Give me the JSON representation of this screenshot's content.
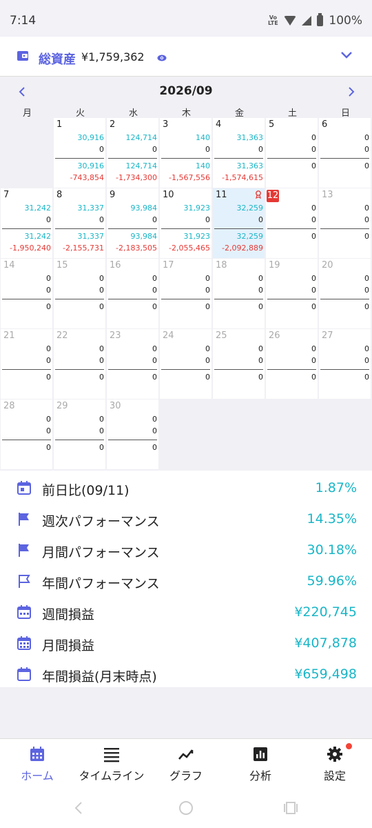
{
  "status": {
    "time": "7:14",
    "volte": "Vo LTE",
    "battery": "100%"
  },
  "asset": {
    "label": "総資産",
    "value": "¥1,759,362"
  },
  "calendar": {
    "month": "2026/09",
    "weekdays": [
      "月",
      "火",
      "水",
      "木",
      "金",
      "土",
      "日"
    ],
    "days": [
      {
        "d": "1",
        "col": 1,
        "row": 0,
        "v1": "30,916",
        "v2": "0",
        "v3": "30,916",
        "v4": "-743,854"
      },
      {
        "d": "2",
        "col": 2,
        "row": 0,
        "v1": "124,714",
        "v2": "0",
        "v3": "124,714",
        "v4": "-1,734,300"
      },
      {
        "d": "3",
        "col": 3,
        "row": 0,
        "v1": "140",
        "v2": "0",
        "v3": "140",
        "v4": "-1,567,556"
      },
      {
        "d": "4",
        "col": 4,
        "row": 0,
        "v1": "31,363",
        "v2": "0",
        "v3": "31,363",
        "v4": "-1,574,615"
      },
      {
        "d": "5",
        "col": 5,
        "row": 0,
        "v1": "0",
        "v2": "0",
        "v3": "0",
        "v4": ""
      },
      {
        "d": "6",
        "col": 6,
        "row": 0,
        "v1": "0",
        "v2": "0",
        "v3": "0",
        "v4": ""
      },
      {
        "d": "7",
        "col": 0,
        "row": 1,
        "v1": "31,242",
        "v2": "0",
        "v3": "31,242",
        "v4": "-1,950,240"
      },
      {
        "d": "8",
        "col": 1,
        "row": 1,
        "v1": "31,337",
        "v2": "0",
        "v3": "31,337",
        "v4": "-2,155,731"
      },
      {
        "d": "9",
        "col": 2,
        "row": 1,
        "v1": "93,984",
        "v2": "0",
        "v3": "93,984",
        "v4": "-2,183,505"
      },
      {
        "d": "10",
        "col": 3,
        "row": 1,
        "v1": "31,923",
        "v2": "0",
        "v3": "31,923",
        "v4": "-2,055,465"
      },
      {
        "d": "11",
        "col": 4,
        "row": 1,
        "v1": "32,259",
        "v2": "0",
        "v3": "32,259",
        "v4": "-2,092,889",
        "today": true
      },
      {
        "d": "12",
        "col": 5,
        "row": 1,
        "v1": "0",
        "v2": "0",
        "v3": "0",
        "v4": "",
        "selected": true
      },
      {
        "d": "13",
        "col": 6,
        "row": 1,
        "v1": "0",
        "v2": "0",
        "v3": "0",
        "v4": "",
        "muted": true
      },
      {
        "d": "14",
        "col": 0,
        "row": 2,
        "v1": "0",
        "v2": "0",
        "v3": "0",
        "v4": "",
        "muted": true
      },
      {
        "d": "15",
        "col": 1,
        "row": 2,
        "v1": "0",
        "v2": "0",
        "v3": "0",
        "v4": "",
        "muted": true
      },
      {
        "d": "16",
        "col": 2,
        "row": 2,
        "v1": "0",
        "v2": "0",
        "v3": "0",
        "v4": "",
        "muted": true
      },
      {
        "d": "17",
        "col": 3,
        "row": 2,
        "v1": "0",
        "v2": "0",
        "v3": "0",
        "v4": "",
        "muted": true
      },
      {
        "d": "18",
        "col": 4,
        "row": 2,
        "v1": "0",
        "v2": "0",
        "v3": "0",
        "v4": "",
        "muted": true
      },
      {
        "d": "19",
        "col": 5,
        "row": 2,
        "v1": "0",
        "v2": "0",
        "v3": "0",
        "v4": "",
        "muted": true
      },
      {
        "d": "20",
        "col": 6,
        "row": 2,
        "v1": "0",
        "v2": "0",
        "v3": "0",
        "v4": "",
        "muted": true
      },
      {
        "d": "21",
        "col": 0,
        "row": 3,
        "v1": "0",
        "v2": "0",
        "v3": "0",
        "v4": "",
        "muted": true
      },
      {
        "d": "22",
        "col": 1,
        "row": 3,
        "v1": "0",
        "v2": "0",
        "v3": "0",
        "v4": "",
        "muted": true
      },
      {
        "d": "23",
        "col": 2,
        "row": 3,
        "v1": "0",
        "v2": "0",
        "v3": "0",
        "v4": "",
        "muted": true
      },
      {
        "d": "24",
        "col": 3,
        "row": 3,
        "v1": "0",
        "v2": "0",
        "v3": "0",
        "v4": "",
        "muted": true
      },
      {
        "d": "25",
        "col": 4,
        "row": 3,
        "v1": "0",
        "v2": "0",
        "v3": "0",
        "v4": "",
        "muted": true
      },
      {
        "d": "26",
        "col": 5,
        "row": 3,
        "v1": "0",
        "v2": "0",
        "v3": "0",
        "v4": "",
        "muted": true
      },
      {
        "d": "27",
        "col": 6,
        "row": 3,
        "v1": "0",
        "v2": "0",
        "v3": "0",
        "v4": "",
        "muted": true
      },
      {
        "d": "28",
        "col": 0,
        "row": 4,
        "v1": "0",
        "v2": "0",
        "v3": "0",
        "v4": "",
        "muted": true
      },
      {
        "d": "29",
        "col": 1,
        "row": 4,
        "v1": "0",
        "v2": "0",
        "v3": "0",
        "v4": "",
        "muted": true
      },
      {
        "d": "30",
        "col": 2,
        "row": 4,
        "v1": "0",
        "v2": "0",
        "v3": "0",
        "v4": "",
        "muted": true
      }
    ]
  },
  "summary": [
    {
      "icon": "calendar-day-icon",
      "label": "前日比(09/11)",
      "value": "1.87%"
    },
    {
      "icon": "flag-icon",
      "label": "週次パフォーマンス",
      "value": "14.35%"
    },
    {
      "icon": "flag-icon",
      "label": "月間パフォーマンス",
      "value": "30.18%"
    },
    {
      "icon": "flag-outline-icon",
      "label": "年間パフォーマンス",
      "value": "59.96%"
    },
    {
      "icon": "calendar-week-icon",
      "label": "週間損益",
      "value": "¥220,745"
    },
    {
      "icon": "calendar-month-icon",
      "label": "月間損益",
      "value": "¥407,878"
    },
    {
      "icon": "calendar-icon",
      "label": "年間損益(月末時点)",
      "value": "¥659,498"
    }
  ],
  "nav": {
    "tabs": [
      {
        "label": "ホーム",
        "icon": "calendar-grid-icon",
        "active": true
      },
      {
        "label": "タイムライン",
        "icon": "list-icon"
      },
      {
        "label": "グラフ",
        "icon": "trend-icon"
      },
      {
        "label": "分析",
        "icon": "bar-chart-icon"
      },
      {
        "label": "設定",
        "icon": "gear-icon",
        "dot": true
      }
    ]
  },
  "colors": {
    "accent": "#5c64e0",
    "positive": "#19b6c7",
    "negative": "#e53935",
    "today_bg": "#e3f1fc"
  }
}
